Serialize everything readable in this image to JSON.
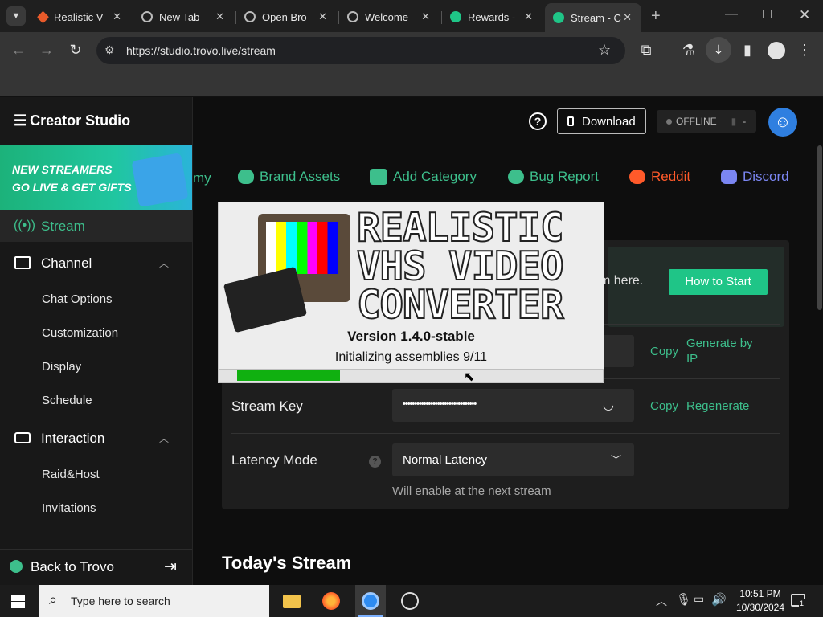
{
  "tabs": [
    {
      "title": "Realistic V",
      "color": "#e85a2a"
    },
    {
      "title": "New Tab",
      "color": "#aaaaaa"
    },
    {
      "title": "Open Bro",
      "color": "#aaaaaa"
    },
    {
      "title": "Welcome",
      "color": "#aaaaaa"
    },
    {
      "title": "Rewards -",
      "color": "#1fc587"
    },
    {
      "title": "Stream - C",
      "color": "#1fc587"
    }
  ],
  "address": {
    "url": "https://studio.trovo.live/stream"
  },
  "header": {
    "logo": "Creator Studio",
    "download": "Download",
    "status": "OFFLINE",
    "status_dash": "-"
  },
  "banner": {
    "line1": "NEW STREAMERS",
    "line2": "GO LIVE & GET GIFTS"
  },
  "sidebar": {
    "stream": "Stream",
    "channel": "Channel",
    "channel_items": [
      "Chat Options",
      "Customization",
      "Display",
      "Schedule"
    ],
    "interaction": "Interaction",
    "interaction_items": [
      "Raid&Host",
      "Invitations"
    ],
    "back": "Back to Trovo"
  },
  "topnav": {
    "partial": "my",
    "items": [
      "Brand Assets",
      "Add Category",
      "Bug Report",
      "Reddit",
      "Discord"
    ]
  },
  "settings": {
    "intro_tail": "m here.",
    "how_to_start": "How to Start",
    "copy": "Copy",
    "generate_by_ip": "Generate by IP",
    "stream_key_label": "Stream Key",
    "stream_key_value": "••••••••••••••••••••••••••••••••",
    "regenerate": "Regenerate",
    "latency_label": "Latency Mode",
    "latency_value": "Normal Latency",
    "latency_note": "Will enable at the next stream"
  },
  "todays_stream": "Today's Stream",
  "splash": {
    "title_lines": [
      "REALISTIC",
      "VHS VIDEO",
      "CONVERTER"
    ],
    "version": "Version 1.4.0-stable",
    "status": "Initializing assemblies 9/11",
    "progress": 0.33
  },
  "taskbar": {
    "search_placeholder": "Type here to search",
    "time": "10:51 PM",
    "date": "10/30/2024",
    "notifications": "1"
  },
  "colors": {
    "accent": "#1fc587",
    "chrome": "#353535"
  }
}
